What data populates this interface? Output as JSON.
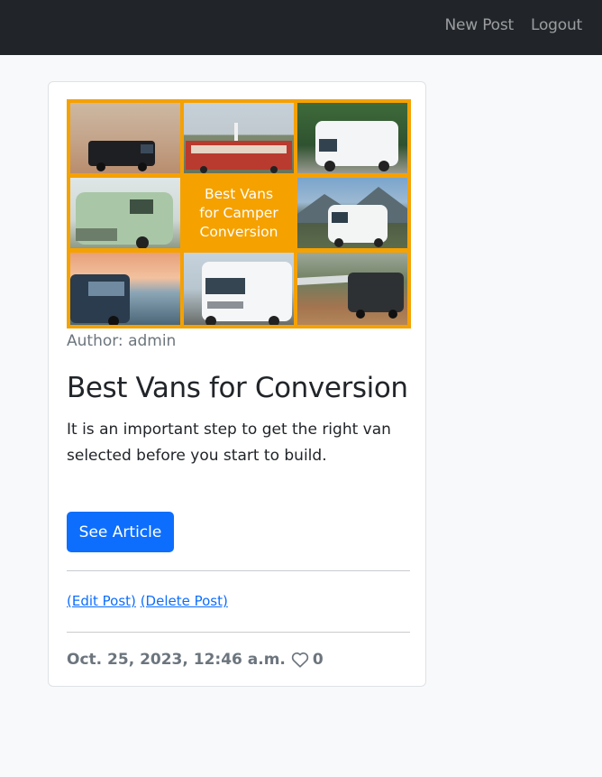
{
  "nav": {
    "new_post": "New Post",
    "logout": "Logout"
  },
  "post": {
    "thumbnail_text_line1": "Best Vans",
    "thumbnail_text_line2": "for Camper",
    "thumbnail_text_line3": "Conversion",
    "author": "Author: admin",
    "title": "Best Vans for Conversion",
    "excerpt": "It is an important step to get the right van selected before you start to build.",
    "button_label": "See Article",
    "edit_label": "(Edit Post)",
    "delete_label": "(Delete Post)",
    "date": "Oct. 25, 2023, 12:46 a.m.",
    "likes": "0"
  },
  "colors": {
    "navbar": "#212529",
    "accent": "#0d6efd",
    "thumbnail_border": "#f5a100"
  },
  "icons": {
    "like": "heart-outline-icon"
  }
}
